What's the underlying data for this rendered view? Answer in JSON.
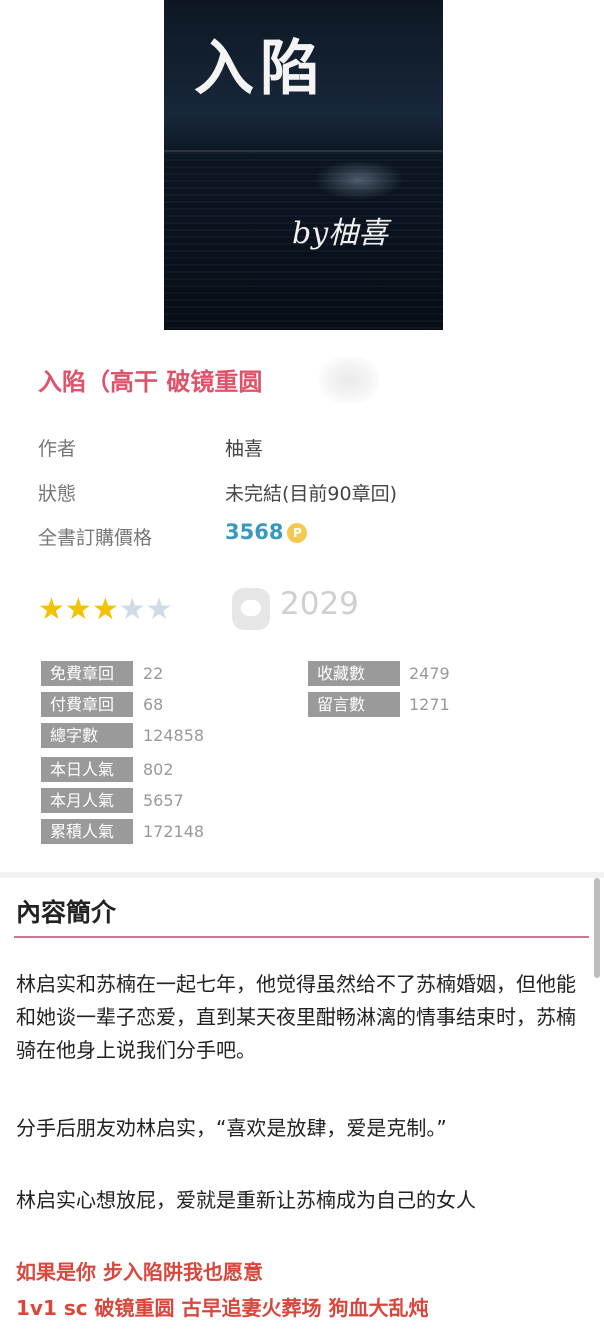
{
  "cover": {
    "title": "入陷",
    "author_mark": "by柚喜"
  },
  "book": {
    "title": "入陷（高干 破镜重圆 "
  },
  "info": [
    {
      "label": "作者",
      "value": "柚喜"
    },
    {
      "label": "狀態",
      "value": "未完結(目前90章回)"
    },
    {
      "label": "全書訂購價格",
      "value": "3568"
    }
  ],
  "coin_glyph": "P",
  "rating": {
    "stars_filled": 3,
    "stars_total": 5
  },
  "piggy_count": "2029",
  "stats_left": [
    {
      "label": "免費章回",
      "value": "22"
    },
    {
      "label": "付費章回",
      "value": "68"
    },
    {
      "label": "總字數",
      "value": "124858"
    },
    {
      "label": "本日人氣",
      "value": "802"
    },
    {
      "label": "本月人氣",
      "value": "5657"
    },
    {
      "label": "累積人氣",
      "value": "172148"
    }
  ],
  "stats_right": [
    {
      "label": "收藏數",
      "value": "2479"
    },
    {
      "label": "留言數",
      "value": "1271"
    }
  ],
  "intro": {
    "heading": "內容簡介",
    "paragraphs": [
      "林启实和苏楠在一起七年，他觉得虽然给不了苏楠婚姻，但他能和她谈一辈子恋爱，直到某天夜里酣畅淋漓的情事结束时，苏楠骑在他身上说我们分手吧。",
      "分手后朋友劝林启实，“喜欢是放肆，爱是克制。”",
      "林启实心想放屁，爱就是重新让苏楠成为自己的女人"
    ],
    "tagline1": "如果是你 步入陷阱我也愿意",
    "tagline2": "1v1 sc 破镜重圆 古早追妻火葬场 狗血大乱炖"
  },
  "colors": {
    "title": "#e0526a",
    "price": "#3a98c0",
    "tagline": "#d9473c",
    "stat_label_bg": "#9a9a9a"
  }
}
